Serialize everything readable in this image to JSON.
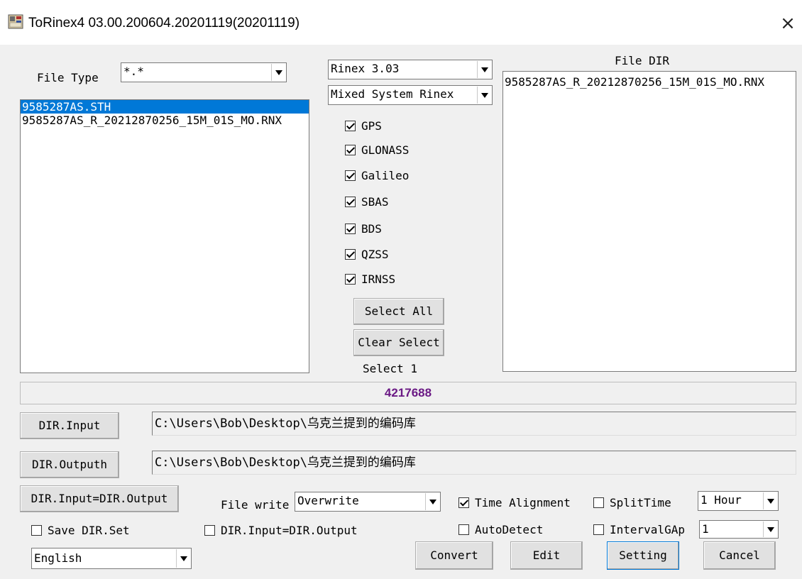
{
  "window": {
    "title": "ToRinex4 03.00.200604.20201119(20201119)",
    "close_symbol": "×"
  },
  "file_type": {
    "label": "File Type",
    "value": "*.*"
  },
  "file_list": [
    "9585287AS.STH",
    "9585287AS_R_20212870256_15M_01S_MO.RNX"
  ],
  "rinex_version": {
    "value": "Rinex 3.03"
  },
  "system_mode": {
    "value": "Mixed System Rinex"
  },
  "systems": [
    {
      "label": "GPS",
      "checked": true
    },
    {
      "label": "GLONASS",
      "checked": true
    },
    {
      "label": "Galileo",
      "checked": true
    },
    {
      "label": "SBAS",
      "checked": true
    },
    {
      "label": "BDS",
      "checked": true
    },
    {
      "label": "QZSS",
      "checked": true
    },
    {
      "label": "IRNSS",
      "checked": true
    }
  ],
  "select_all_label": "Select All",
  "clear_select_label": "Clear Select",
  "select_count_text": "Select 1",
  "file_dir": {
    "label": "File DIR",
    "items": [
      "9585287AS_R_20212870256_15M_01S_MO.RNX"
    ]
  },
  "status_value": "4217688",
  "dir_input": {
    "button_label": "DIR.Input",
    "path": "C:\\Users\\Bob\\Desktop\\乌克兰提到的编码库"
  },
  "dir_output": {
    "button_label": "DIR.Outputh",
    "path": "C:\\Users\\Bob\\Desktop\\乌克兰提到的编码库"
  },
  "dir_copy_button": "DIR.Input=DIR.Output",
  "file_write": {
    "label": "File write",
    "value": "Overwrite"
  },
  "time_alignment": {
    "label": "Time Alignment",
    "checked": true
  },
  "split_time": {
    "label": "SplitTime",
    "checked": false,
    "value": "1 Hour"
  },
  "save_dir_set": {
    "label": "Save DIR.Set",
    "checked": false
  },
  "dir_same": {
    "label": "DIR.Input=DIR.Output",
    "checked": false
  },
  "auto_detect": {
    "label": "AutoDetect",
    "checked": false
  },
  "interval_gap": {
    "label": "IntervalGAp",
    "checked": false,
    "value": "1"
  },
  "language": {
    "value": "English"
  },
  "buttons": {
    "convert": "Convert",
    "edit": "Edit",
    "setting": "Setting",
    "cancel": "Cancel"
  }
}
